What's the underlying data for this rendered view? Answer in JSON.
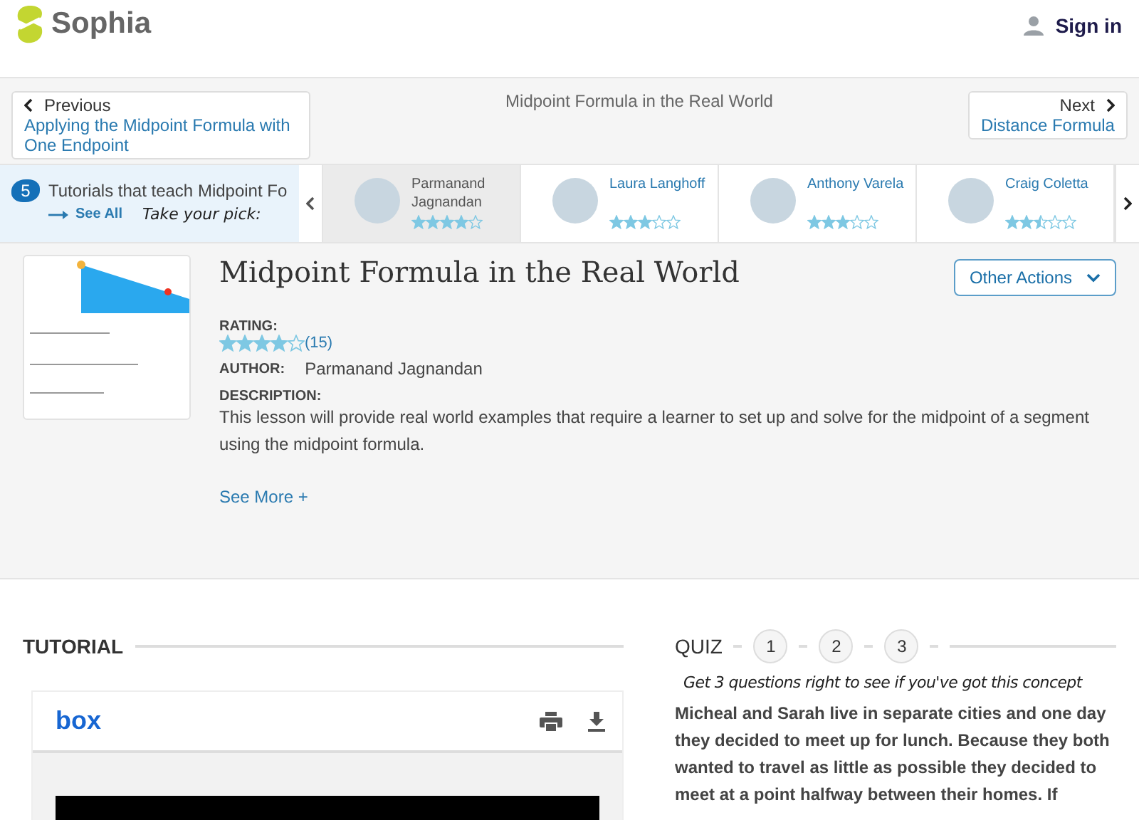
{
  "header": {
    "logo": "Sophia",
    "sign_in": "Sign in"
  },
  "nav": {
    "previous": {
      "label": "Previous",
      "title": "Applying the Midpoint Formula with One Endpoint"
    },
    "current": "Midpoint Formula in the Real World",
    "next": {
      "label": "Next",
      "title": "Distance Formula"
    }
  },
  "carousel": {
    "count": "5",
    "heading": "Tutorials that teach Midpoint Fo",
    "see_all": "See All",
    "tagline": "Take your pick:",
    "tutorials": [
      {
        "author": "Parmanand Jagnandan",
        "stars": 4,
        "selected": true
      },
      {
        "author": "Laura Langhoff",
        "stars": 3,
        "selected": false
      },
      {
        "author": "Anthony Varela",
        "stars": 3,
        "selected": false
      },
      {
        "author": "Craig Coletta",
        "stars": 2.5,
        "selected": false
      }
    ]
  },
  "lesson": {
    "title": "Midpoint Formula in the Real World",
    "other_actions": "Other Actions",
    "rating_label": "RATING:",
    "stars": 4,
    "rating_count": "(15)",
    "author_label": "AUTHOR:",
    "author": "Parmanand Jagnandan",
    "description_label": "DESCRIPTION:",
    "description": "This lesson will provide real world examples that require a learner to set up and solve for the midpoint of a segment using the midpoint formula.",
    "see_more": "See More +"
  },
  "tutorial": {
    "heading": "TUTORIAL",
    "viewer_logo": "box"
  },
  "quiz": {
    "heading": "QUIZ",
    "questions": [
      "1",
      "2",
      "3"
    ],
    "tagline": "Get 3 questions right to see if you've got this concept",
    "text": "Micheal and Sarah live in separate cities and one day they decided to meet up for lunch. Because they both wanted to travel as little as possible they decided to meet at a point halfway between their homes. If"
  }
}
